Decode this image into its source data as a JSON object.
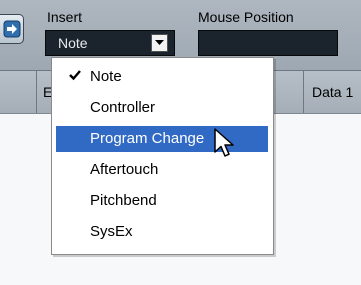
{
  "toolbar": {
    "insert_label": "Insert",
    "insert_value": "Note",
    "mouse_position_label": "Mouse Position",
    "mouse_position_value": ""
  },
  "table": {
    "headers": [
      "E",
      "Data 1"
    ]
  },
  "insert_menu": {
    "items": [
      {
        "label": "Note",
        "checked": true,
        "highlighted": false
      },
      {
        "label": "Controller",
        "checked": false,
        "highlighted": false
      },
      {
        "label": "Program Change",
        "checked": false,
        "highlighted": true
      },
      {
        "label": "Aftertouch",
        "checked": false,
        "highlighted": false
      },
      {
        "label": "Pitchbend",
        "checked": false,
        "highlighted": false
      },
      {
        "label": "SysEx",
        "checked": false,
        "highlighted": false
      }
    ]
  },
  "icons": {
    "nav_button": "arrow-right-into-box-icon",
    "dropdown": "chevron-down-icon",
    "checkmark": "check-icon",
    "cursor": "mouse-pointer-icon"
  },
  "colors": {
    "menu_highlight": "#316ac5",
    "field_background": "#1b232c"
  }
}
